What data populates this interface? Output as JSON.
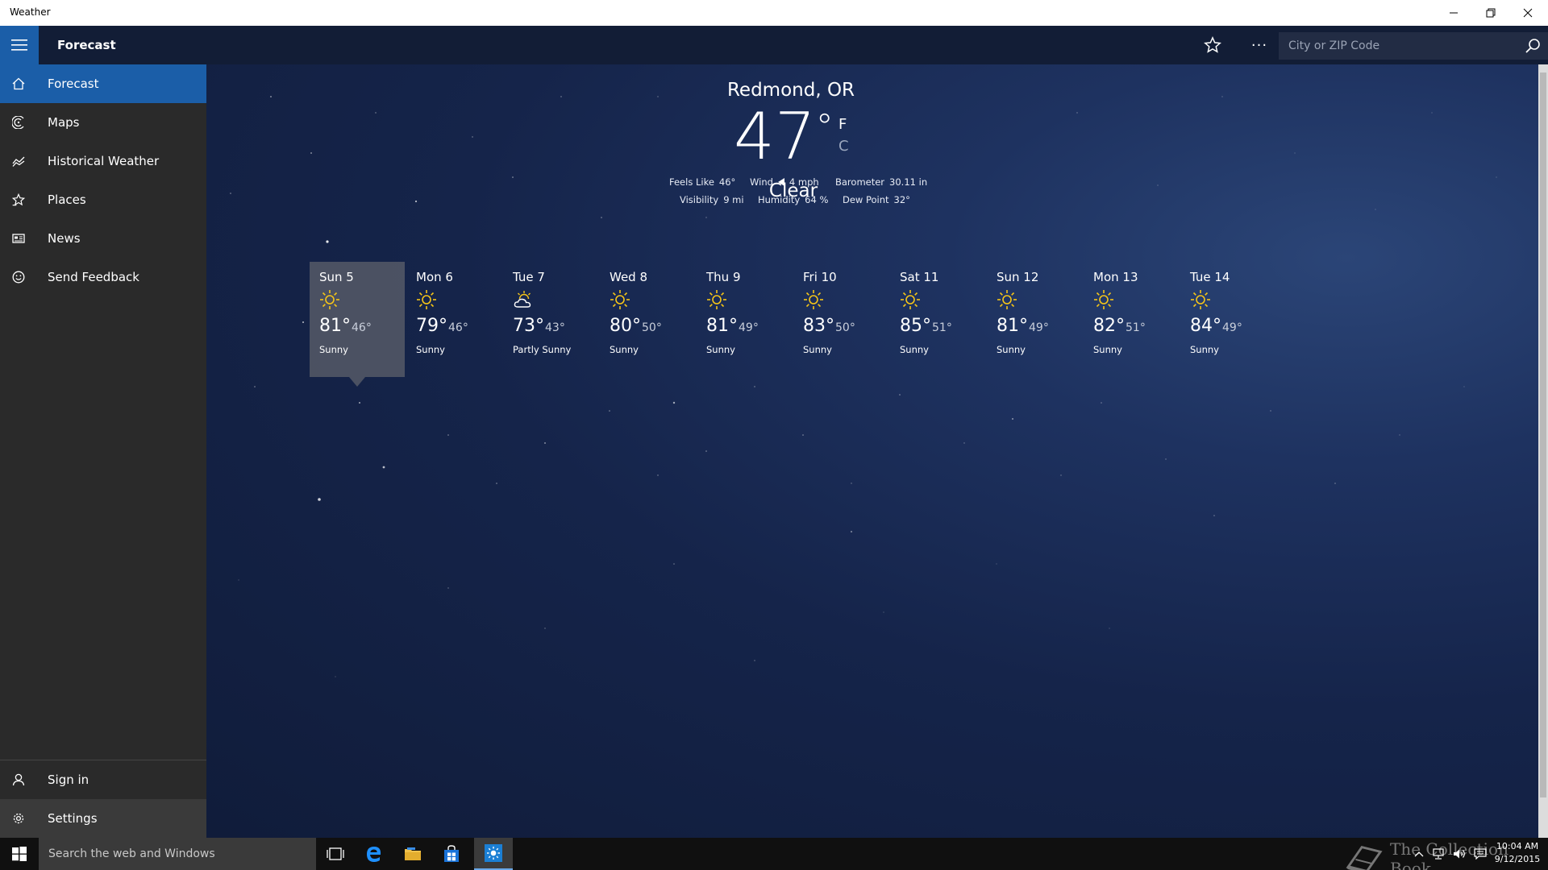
{
  "window": {
    "title": "Weather"
  },
  "header": {
    "page_title": "Forecast",
    "search_placeholder": "City or ZIP Code"
  },
  "sidebar": {
    "items": [
      {
        "label": "Forecast",
        "icon": "home-icon"
      },
      {
        "label": "Maps",
        "icon": "maps-icon"
      },
      {
        "label": "Historical Weather",
        "icon": "chart-icon"
      },
      {
        "label": "Places",
        "icon": "places-star-icon"
      },
      {
        "label": "News",
        "icon": "news-icon"
      },
      {
        "label": "Send Feedback",
        "icon": "smiley-icon"
      }
    ],
    "bottom_items": [
      {
        "label": "Sign in",
        "icon": "person-icon"
      },
      {
        "label": "Settings",
        "icon": "gear-icon"
      }
    ]
  },
  "current": {
    "location": "Redmond, OR",
    "temperature": "47",
    "degree_symbol": "°",
    "unit_f": "F",
    "unit_c": "C",
    "condition": "Clear",
    "details": {
      "feels_like_label": "Feels Like",
      "feels_like_value": "46°",
      "wind_label": "Wind",
      "wind_value": "4 mph",
      "barometer_label": "Barometer",
      "barometer_value": "30.11 in",
      "visibility_label": "Visibility",
      "visibility_value": "9 mi",
      "humidity_label": "Humidity",
      "humidity_value": "64 %",
      "dew_point_label": "Dew Point",
      "dew_point_value": "32°"
    }
  },
  "forecast": [
    {
      "day": "Sun 5",
      "hi": "81°",
      "lo": "46°",
      "condition": "Sunny",
      "icon": "sun-icon",
      "selected": true
    },
    {
      "day": "Mon 6",
      "hi": "79°",
      "lo": "46°",
      "condition": "Sunny",
      "icon": "sun-icon"
    },
    {
      "day": "Tue 7",
      "hi": "73°",
      "lo": "43°",
      "condition": "Partly Sunny",
      "icon": "partly-sunny-icon"
    },
    {
      "day": "Wed 8",
      "hi": "80°",
      "lo": "50°",
      "condition": "Sunny",
      "icon": "sun-icon"
    },
    {
      "day": "Thu 9",
      "hi": "81°",
      "lo": "49°",
      "condition": "Sunny",
      "icon": "sun-icon"
    },
    {
      "day": "Fri 10",
      "hi": "83°",
      "lo": "50°",
      "condition": "Sunny",
      "icon": "sun-icon"
    },
    {
      "day": "Sat 11",
      "hi": "85°",
      "lo": "51°",
      "condition": "Sunny",
      "icon": "sun-icon"
    },
    {
      "day": "Sun 12",
      "hi": "81°",
      "lo": "49°",
      "condition": "Sunny",
      "icon": "sun-icon"
    },
    {
      "day": "Mon 13",
      "hi": "82°",
      "lo": "51°",
      "condition": "Sunny",
      "icon": "sun-icon"
    },
    {
      "day": "Tue 14",
      "hi": "84°",
      "lo": "49°",
      "condition": "Sunny",
      "icon": "sun-icon"
    }
  ],
  "taskbar": {
    "search_placeholder": "Search the web and Windows",
    "watermark": "The Collection Book",
    "time": "10:04 AM",
    "date": "9/12/2015"
  },
  "colors": {
    "accent": "#1b5ea8",
    "sidebar_bg": "#2a2a2a",
    "sun_yellow": "#f5c518"
  }
}
